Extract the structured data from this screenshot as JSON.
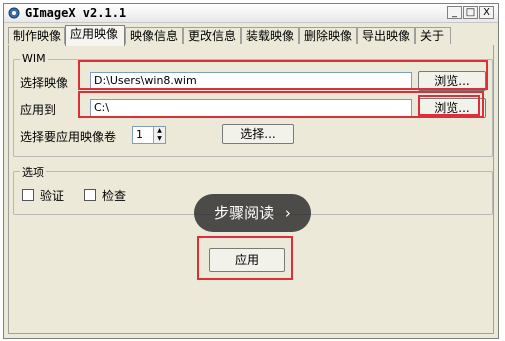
{
  "window": {
    "title": "GImageX v2.1.1",
    "controls": [
      "_",
      "□",
      "X"
    ]
  },
  "tabs": [
    {
      "label": "制作映像",
      "active": false
    },
    {
      "label": "应用映像",
      "active": true
    },
    {
      "label": "映像信息",
      "active": false
    },
    {
      "label": "更改信息",
      "active": false
    },
    {
      "label": "装载映像",
      "active": false
    },
    {
      "label": "删除映像",
      "active": false
    },
    {
      "label": "导出映像",
      "active": false
    },
    {
      "label": "关于",
      "active": false
    }
  ],
  "wim_group": {
    "title": "WIM",
    "select_image_label": "选择映像",
    "select_image_value": "D:\\Users\\win8.wim",
    "browse1": "浏览...",
    "apply_to_label": "应用到",
    "apply_to_value": "C:\\",
    "browse2": "浏览...",
    "volume_label": "选择要应用映像卷",
    "volume_value": "1",
    "choose_button": "选择..."
  },
  "options_group": {
    "title": "选项",
    "verify_label": "验证",
    "verify_checked": false,
    "check_label": "检查",
    "check_checked": false
  },
  "apply_button": "应用",
  "overlay": {
    "text": "步骤阅读",
    "chevron": "›"
  },
  "colors": {
    "highlight": "#d9303a",
    "window_bg": "#ece9d8"
  }
}
